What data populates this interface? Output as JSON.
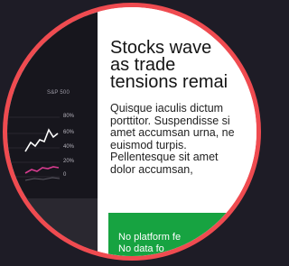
{
  "chart_panel": {
    "index_label": "S&P 500",
    "ticks": [
      "80%",
      "60%",
      "40%",
      "20%",
      "0"
    ]
  },
  "article": {
    "headline_lines": [
      "Stocks wave",
      "as trade",
      "tensions remai"
    ],
    "body_lines": [
      "Quisque iaculis dictum",
      "porttitor. Suspendisse si",
      "amet accumsan urna, ne",
      "euismod turpis.",
      "Pellentesque sit amet",
      "dolor accumsan,"
    ]
  },
  "status_banner": {
    "lines": [
      "No platform fe",
      "No data fo"
    ]
  },
  "colors": {
    "ring": "#ef4b50",
    "banner": "#17a341",
    "background": "#1e1c26"
  }
}
